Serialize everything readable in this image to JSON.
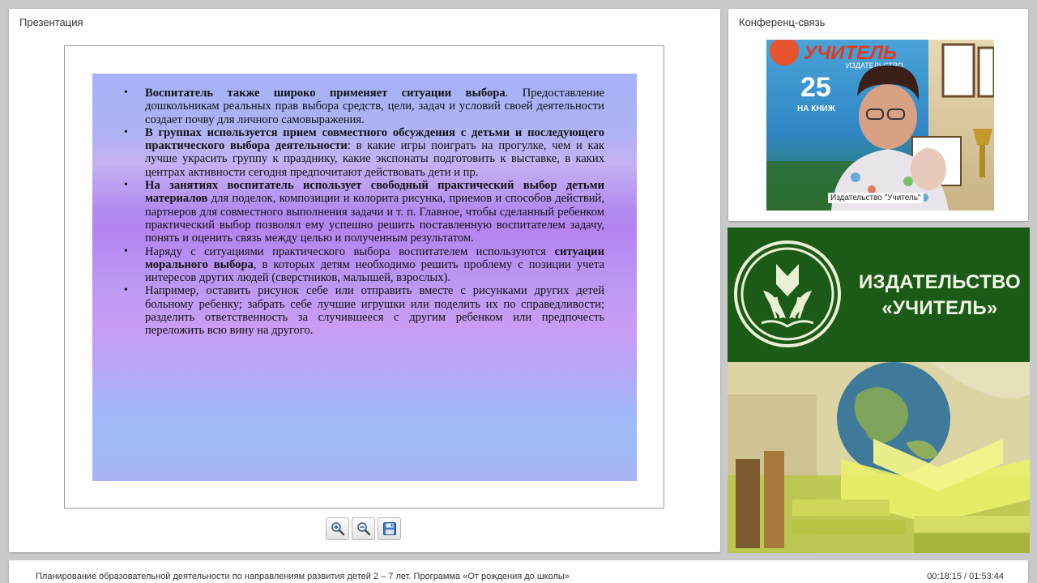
{
  "presentation": {
    "title": "Презентация",
    "slide": {
      "bullets": [
        {
          "bold": "Воспитатель также широко применяет ситуации выбора",
          "text": ". Предоставление дошкольникам реальных прав выбора средств, цели, задач и условий своей деятельности создает почву для личного самовыражения."
        },
        {
          "bold": "В группах используется прием совместного обсуждения с детьми и последующего практического выбора деятельности",
          "text": ": в какие игры поиграть на прогулке, чем и как лучше украсить группу к празднику, какие экспонаты подготовить к выставке, в каких центрах активности сегодня предпочитают действовать дети и пр."
        },
        {
          "bold": "На занятиях воспитатель использует свободный практический выбор детьми материалов",
          "text": " для поделок, композиции и колорита рисунка, приемов и способов действий, партнеров для совместного выполнения задачи и т. п. Главное, чтобы сделанный ребенком практический выбор позволял ему успешно решить поставленную воспитателем задачу, понять и оценить связь между целью и полученным результатом."
        },
        {
          "pre": "Наряду с ситуациями практического выбора воспитателем используются ",
          "bold": "ситуации морального выбора",
          "text": ", в которых детям необходимо решить проблему с позиции учета интересов других людей (сверстников, малышей, взрослых)."
        },
        {
          "text": "Например, оставить рисунок себе или отправить вместе с рисунками других детей больному ребенку; забрать себе лучшие игрушки или поделить их по справедливости; разделить ответственность за случившееся с другим ребенком или предпочесть переложить всю вину на другого."
        }
      ]
    },
    "toolbar": {
      "zoom_in_icon": "zoom-in-icon",
      "zoom_out_icon": "zoom-out-icon",
      "save_icon": "floppy-disk-icon"
    }
  },
  "conference": {
    "title": "Конференц-связь",
    "camera_label": "Издательство \"Учитель\"",
    "poster_text": "УЧИТЕЛЬ",
    "poster_sub": "ИЗДАТЕЛЬСТВО",
    "poster_number": "25",
    "poster_tag": "НА КНИЖ"
  },
  "banner": {
    "line1": "ИЗДАТЕЛЬСТВО",
    "line2": "«УЧИТЕЛЬ»"
  },
  "footer": {
    "title": "Планирование образовательной деятельности по направлениям развития детей 2 – 7 лет. Программа «От рождения до школы»",
    "time": "00:18:15 / 01:53:44"
  },
  "colors": {
    "banner_green": "#1c5b17",
    "page_bg": "#c9c9c9"
  }
}
